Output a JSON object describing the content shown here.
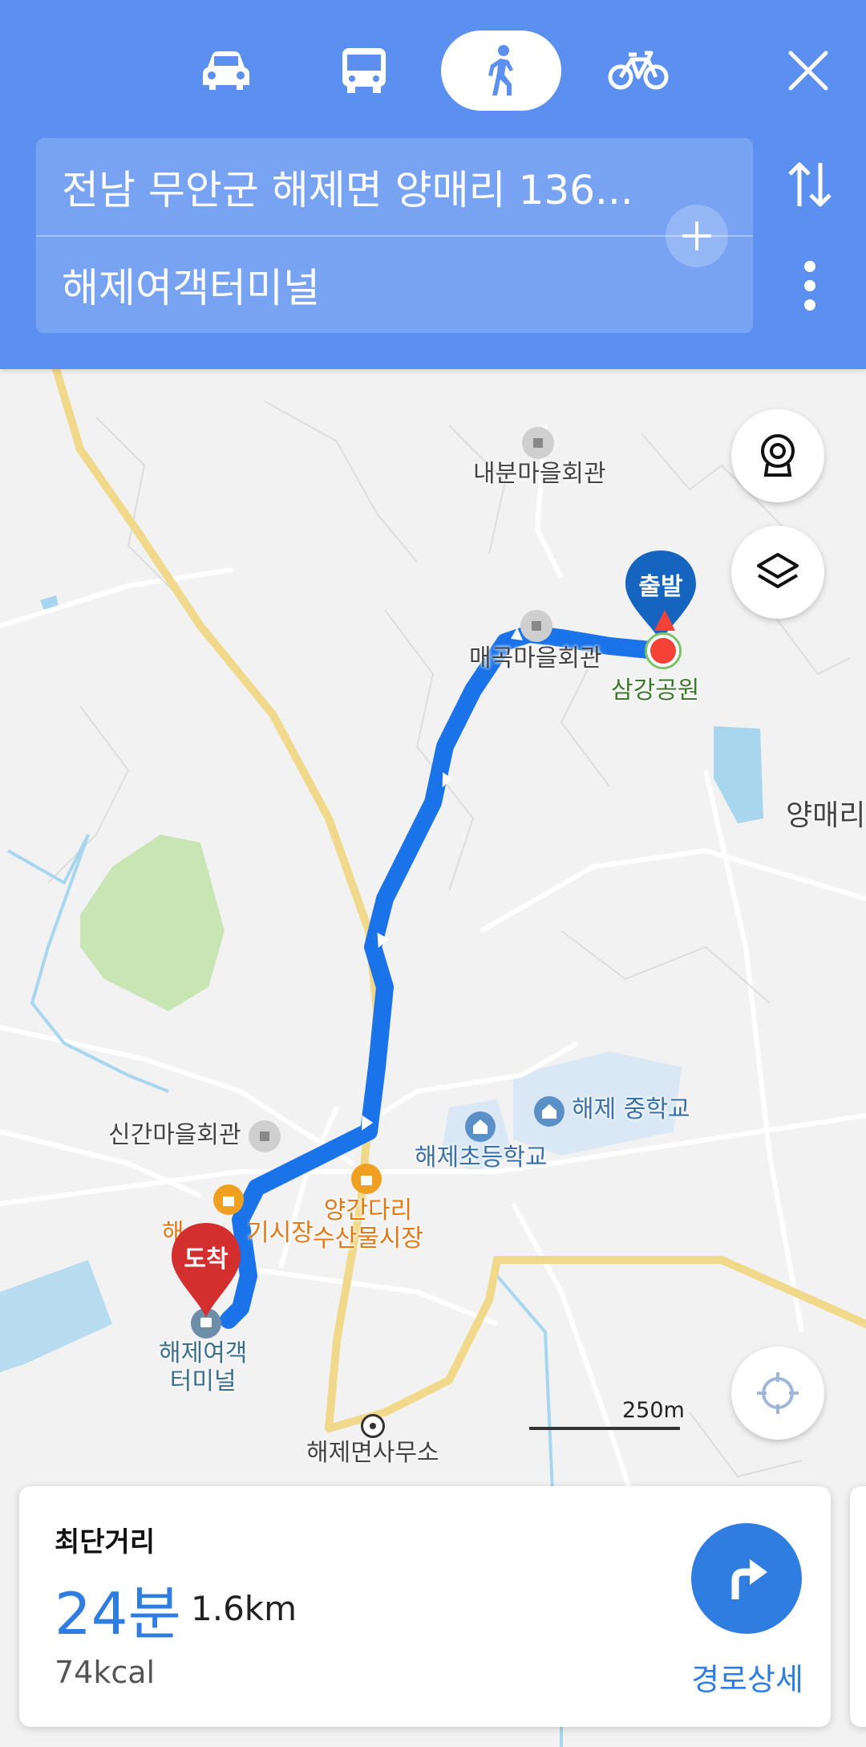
{
  "header": {
    "modes": [
      {
        "name": "car",
        "icon": "car-icon",
        "selected": false
      },
      {
        "name": "bus",
        "icon": "bus-icon",
        "selected": false
      },
      {
        "name": "walk",
        "icon": "walk-icon",
        "selected": true
      },
      {
        "name": "bike",
        "icon": "bike-icon",
        "selected": false
      }
    ],
    "origin": "전남 무안군 해제면 양매리 136...",
    "destination": "해제여객터미널"
  },
  "map": {
    "labels": {
      "naebun": "내분마을회관",
      "maegok": "매곡마을회관",
      "samgang": "삼강공원",
      "yangmae": "양매리",
      "singan": "신간마을회관",
      "haeje_middle": "해제 중학교",
      "haeje_elem": "해제초등학교",
      "market_partial": "해",
      "market_partial2": "기시장",
      "yanggan_1": "양간다리",
      "yanggan_2": "수산물시장",
      "terminal_1": "해제여객",
      "terminal_2": "터미널",
      "office": "해제면사무소"
    },
    "start_pin": "출발",
    "end_pin": "도착",
    "scale": "250m"
  },
  "summary": {
    "title": "최단거리",
    "time": "24분",
    "distance": "1.6km",
    "calories": "74kcal",
    "details_label": "경로상세"
  },
  "colors": {
    "header_bg": "#5b8ff0",
    "route": "#1a73e8",
    "start_pin": "#1565c0",
    "end_pin": "#d32f2f",
    "accent": "#2f7de0"
  }
}
